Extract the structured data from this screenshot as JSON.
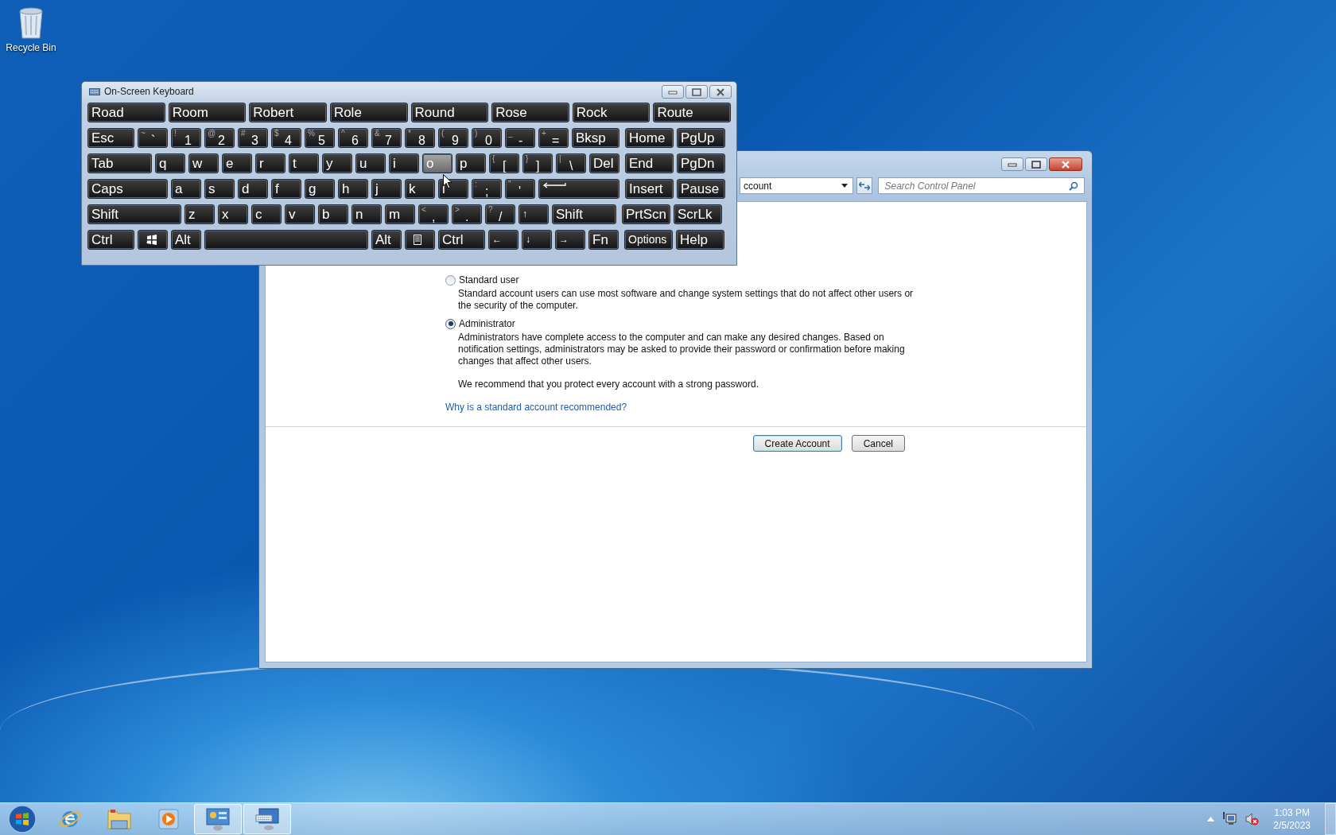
{
  "desktop_icons": [
    {
      "label": "Recycle Bin"
    }
  ],
  "control_panel_window": {
    "address": "ccount",
    "search": {
      "placeholder": "Search Control Panel"
    },
    "account_types": [
      {
        "label": "Standard user",
        "description": "Standard account users can use most software and change system settings that do not affect other users or the security of the computer.",
        "selected": false
      },
      {
        "label": "Administrator",
        "description": "Administrators have complete access to the computer and can make any desired changes. Based on notification settings, administrators may be asked to provide their password or confirmation before making changes that affect other users.",
        "selected": true
      }
    ],
    "note": "We recommend that you protect every account with a strong password.",
    "link": "Why is a standard account recommended?",
    "buttons": [
      {
        "label": "Create Account",
        "default": true
      },
      {
        "label": "Cancel",
        "default": false
      }
    ]
  },
  "keyboard_window": {
    "title": "On-Screen Keyboard",
    "suggestions": [
      "Road",
      "Room",
      "Robert",
      "Role",
      "Round",
      "Rose",
      "Rock",
      "Route"
    ],
    "rows": [
      {
        "main": [
          {
            "kind": "label",
            "label": "Esc",
            "hover": false
          },
          {
            "kind": "char",
            "shift": "~",
            "main": "`",
            "hover": false
          },
          {
            "kind": "char",
            "shift": "!",
            "main": "1",
            "hover": false
          },
          {
            "kind": "char",
            "shift": "@",
            "main": "2",
            "hover": false
          },
          {
            "kind": "char",
            "shift": "#",
            "main": "3",
            "hover": false
          },
          {
            "kind": "char",
            "shift": "$",
            "main": "4",
            "hover": false
          },
          {
            "kind": "char",
            "shift": "%",
            "main": "5",
            "hover": false
          },
          {
            "kind": "char",
            "shift": "^",
            "main": "6",
            "hover": false
          },
          {
            "kind": "char",
            "shift": "&",
            "main": "7",
            "hover": false
          },
          {
            "kind": "char",
            "shift": "*",
            "main": "8",
            "hover": false
          },
          {
            "kind": "char",
            "shift": "(",
            "main": "9",
            "hover": false
          },
          {
            "kind": "char",
            "shift": ")",
            "main": "0",
            "hover": false
          },
          {
            "kind": "char",
            "shift": "_",
            "main": "-",
            "hover": false
          },
          {
            "kind": "char",
            "shift": "+",
            "main": "=",
            "hover": false
          },
          {
            "kind": "label",
            "label": "Bksp",
            "hover": false
          }
        ],
        "nav": [
          {
            "kind": "label",
            "label": "Home",
            "hover": false
          },
          {
            "kind": "label",
            "label": "PgUp",
            "hover": false
          }
        ]
      },
      {
        "main": [
          {
            "kind": "label",
            "label": "Tab",
            "hover": false
          },
          {
            "kind": "label",
            "label": "q",
            "hover": false
          },
          {
            "kind": "label",
            "label": "w",
            "hover": false
          },
          {
            "kind": "label",
            "label": "e",
            "hover": false
          },
          {
            "kind": "label",
            "label": "r",
            "hover": false
          },
          {
            "kind": "label",
            "label": "t",
            "hover": false
          },
          {
            "kind": "label",
            "label": "y",
            "hover": false
          },
          {
            "kind": "label",
            "label": "u",
            "hover": false
          },
          {
            "kind": "label",
            "label": "i",
            "hover": false
          },
          {
            "kind": "label",
            "label": "o",
            "hover": true
          },
          {
            "kind": "label",
            "label": "p",
            "hover": false
          },
          {
            "kind": "char",
            "shift": "{",
            "main": "[",
            "hover": false
          },
          {
            "kind": "char",
            "shift": "}",
            "main": "]",
            "hover": false
          },
          {
            "kind": "char",
            "shift": "|",
            "main": "\\",
            "hover": false
          },
          {
            "kind": "label",
            "label": "Del",
            "hover": false
          }
        ],
        "nav": [
          {
            "kind": "label",
            "label": "End",
            "hover": false
          },
          {
            "kind": "label",
            "label": "PgDn",
            "hover": false
          }
        ]
      },
      {
        "main": [
          {
            "kind": "label",
            "label": "Caps",
            "hover": false
          },
          {
            "kind": "label",
            "label": "a",
            "hover": false
          },
          {
            "kind": "label",
            "label": "s",
            "hover": false
          },
          {
            "kind": "label",
            "label": "d",
            "hover": false
          },
          {
            "kind": "label",
            "label": "f",
            "hover": false
          },
          {
            "kind": "label",
            "label": "g",
            "hover": false
          },
          {
            "kind": "label",
            "label": "h",
            "hover": false
          },
          {
            "kind": "label",
            "label": "j",
            "hover": false
          },
          {
            "kind": "label",
            "label": "k",
            "hover": false
          },
          {
            "kind": "label",
            "label": "l",
            "hover": false
          },
          {
            "kind": "char",
            "shift": ":",
            "main": ";",
            "hover": false
          },
          {
            "kind": "char",
            "shift": "\"",
            "main": "'",
            "hover": false
          },
          {
            "kind": "enter",
            "hover": false
          }
        ],
        "nav": [
          {
            "kind": "label",
            "label": "Insert",
            "hover": false
          },
          {
            "kind": "label",
            "label": "Pause",
            "hover": false
          }
        ]
      },
      {
        "main": [
          {
            "kind": "label",
            "label": "Shift",
            "hover": false
          },
          {
            "kind": "label",
            "label": "z",
            "hover": false
          },
          {
            "kind": "label",
            "label": "x",
            "hover": false
          },
          {
            "kind": "label",
            "label": "c",
            "hover": false
          },
          {
            "kind": "label",
            "label": "v",
            "hover": false
          },
          {
            "kind": "label",
            "label": "b",
            "hover": false
          },
          {
            "kind": "label",
            "label": "n",
            "hover": false
          },
          {
            "kind": "label",
            "label": "m",
            "hover": false
          },
          {
            "kind": "char",
            "shift": "<",
            "main": ",",
            "hover": false
          },
          {
            "kind": "char",
            "shift": ">",
            "main": ".",
            "hover": false
          },
          {
            "kind": "char",
            "shift": "?",
            "main": "/",
            "hover": false
          },
          {
            "kind": "arrow",
            "label": "↑",
            "hover": false
          },
          {
            "kind": "label",
            "label": "Shift",
            "hover": false
          }
        ],
        "nav": [
          {
            "kind": "label",
            "label": "PrtScn",
            "hover": false
          },
          {
            "kind": "label",
            "label": "ScrLk",
            "hover": false
          }
        ]
      },
      {
        "main": [
          {
            "kind": "label",
            "label": "Ctrl",
            "hover": false
          },
          {
            "kind": "winlogo",
            "hover": false
          },
          {
            "kind": "label",
            "label": "Alt",
            "hover": false
          },
          {
            "kind": "space",
            "hover": false
          },
          {
            "kind": "label",
            "label": "Alt",
            "hover": false
          },
          {
            "kind": "menu",
            "hover": false
          },
          {
            "kind": "label",
            "label": "Ctrl",
            "hover": false
          },
          {
            "kind": "arrow",
            "label": "←",
            "hover": false
          },
          {
            "kind": "arrow",
            "label": "↓",
            "hover": false
          },
          {
            "kind": "arrow",
            "label": "→",
            "hover": false
          },
          {
            "kind": "label",
            "label": "Fn",
            "hover": false
          }
        ],
        "nav": [
          {
            "kind": "small",
            "label": "Options",
            "hover": false
          },
          {
            "kind": "label",
            "label": "Help",
            "hover": false
          }
        ]
      }
    ]
  },
  "taskbar": {
    "items": [
      {
        "kind": "browser",
        "active": false
      },
      {
        "kind": "folder",
        "active": false
      },
      {
        "kind": "media",
        "active": false
      },
      {
        "kind": "control-panel",
        "active": true
      },
      {
        "kind": "keyboard",
        "active": true
      }
    ],
    "time": "1:03 PM",
    "date": "2/5/2023"
  }
}
